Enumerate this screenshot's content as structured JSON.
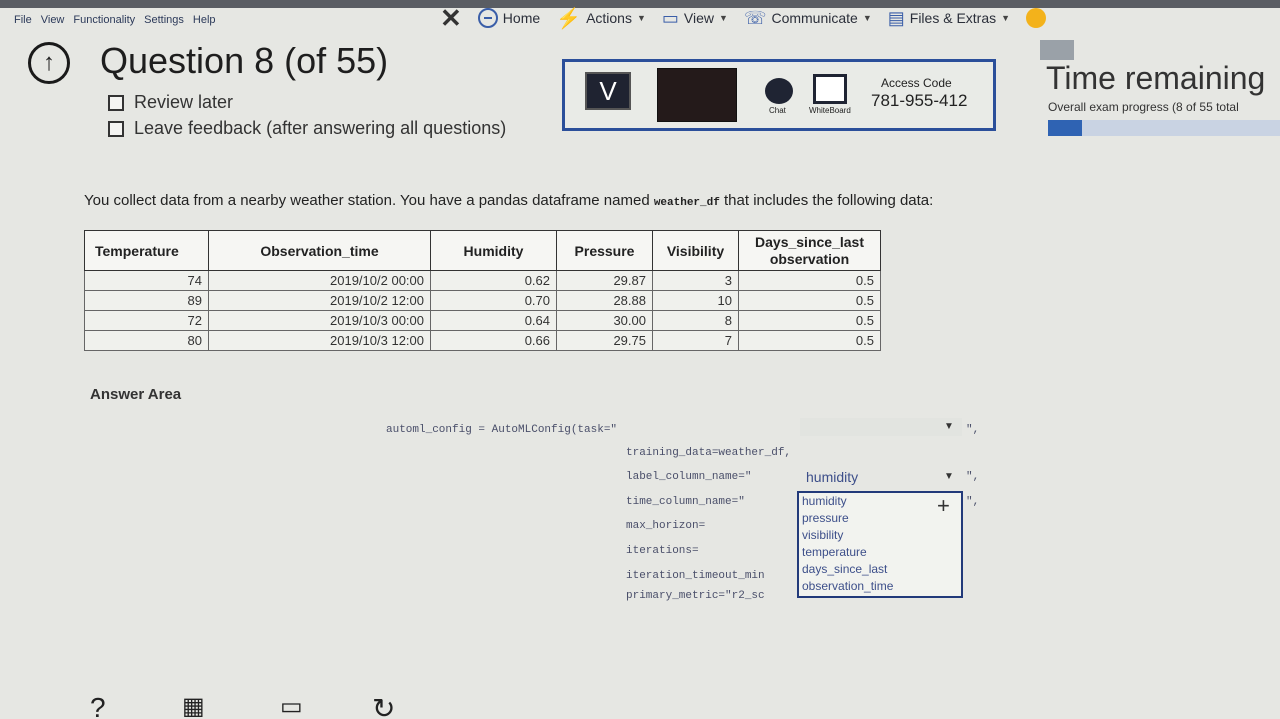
{
  "menu": [
    "File",
    "View",
    "Functionality",
    "Settings",
    "Help"
  ],
  "toolbar": {
    "close_glyph": "✕",
    "items": [
      {
        "label": "Home",
        "icon": "home-icon"
      },
      {
        "label": "Actions",
        "icon": "bolt-icon"
      },
      {
        "label": "View",
        "icon": "monitor-icon"
      },
      {
        "label": "Communicate",
        "icon": "phone-icon"
      },
      {
        "label": "Files & Extras",
        "icon": "files-icon"
      }
    ]
  },
  "question": {
    "title": "Question 8 (of 55)",
    "review_later": "Review later",
    "leave_feedback": "Leave feedback (after answering all questions)"
  },
  "session": {
    "v_label": "V",
    "chat_label": "Chat",
    "whiteboard_label": "WhiteBoard",
    "access_label": "Access Code",
    "access_code": "781-955-412"
  },
  "timer": {
    "title": "Time remaining",
    "progress_text": "Overall exam progress (8 of 55 total",
    "progress_fraction": 0.145
  },
  "prompt": {
    "part1": "You collect data from a nearby weather station. You have a pandas dataframe named ",
    "code": "weather_df",
    "part2": " that includes the following data:"
  },
  "table": {
    "headers": [
      "Temperature",
      "Observation_time",
      "Humidity",
      "Pressure",
      "Visibility",
      "Days_since_last observation"
    ],
    "rows": [
      [
        "74",
        "2019/10/2 00:00",
        "0.62",
        "29.87",
        "3",
        "0.5"
      ],
      [
        "89",
        "2019/10/2 12:00",
        "0.70",
        "28.88",
        "10",
        "0.5"
      ],
      [
        "72",
        "2019/10/3 00:00",
        "0.64",
        "30.00",
        "8",
        "0.5"
      ],
      [
        "80",
        "2019/10/3 12:00",
        "0.66",
        "29.75",
        "7",
        "0.5"
      ]
    ]
  },
  "answer_area": {
    "label": "Answer Area",
    "line1": "automl_config = AutoMLConfig(task=\"",
    "line2": "training_data=weather_df,",
    "line3": "label_column_name=\"",
    "line3_value": "humidity",
    "line4": "time_column_name=\"",
    "line5": "max_horizon=",
    "line6": "iterations=",
    "line7": "iteration_timeout_min",
    "line8": "primary_metric=\"r2_sc",
    "trail": "\",",
    "dropdown_options": [
      "humidity",
      "pressure",
      "visibility",
      "temperature",
      "days_since_last",
      "observation_time"
    ]
  }
}
